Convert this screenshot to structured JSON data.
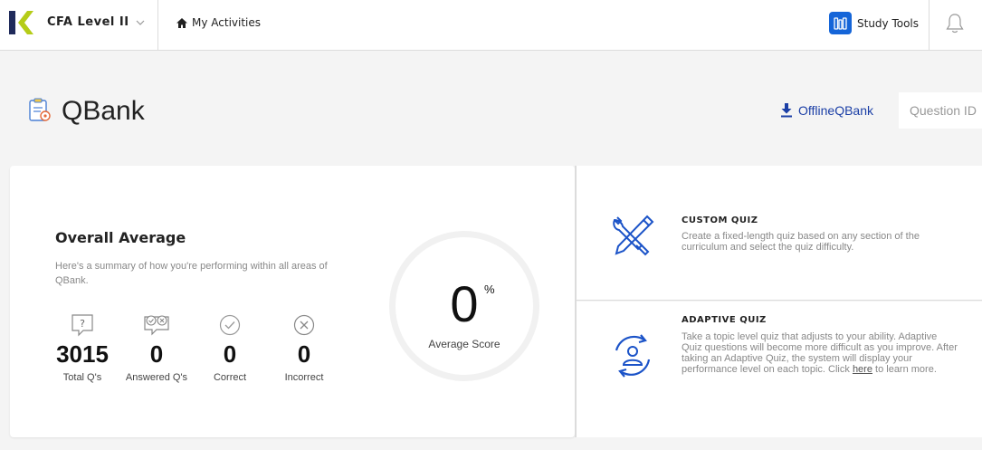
{
  "nav": {
    "course": "CFA Level II",
    "my_activities": "My Activities",
    "study_tools": "Study Tools"
  },
  "header": {
    "title": "QBank",
    "offline": "OfflineQBank",
    "question_id_placeholder": "Question ID"
  },
  "overall": {
    "title": "Overall Average",
    "description": "Here's a summary of how you're performing within all areas of QBank.",
    "stats": [
      {
        "value": "3015",
        "label": "Total Q's"
      },
      {
        "value": "0",
        "label": "Answered Q's"
      },
      {
        "value": "0",
        "label": "Correct"
      },
      {
        "value": "0",
        "label": "Incorrect"
      }
    ],
    "score": "0",
    "score_unit": "%",
    "score_label": "Average Score"
  },
  "quizzes": {
    "custom": {
      "title": "CUSTOM QUIZ",
      "description": "Create a fixed-length quiz based on any section of the curriculum and select the quiz difficulty."
    },
    "adaptive": {
      "title": "ADAPTIVE QUIZ",
      "description": "Take a topic level quiz that adjusts to your ability. Adaptive Quiz questions will become more difficult as you improve. After taking an Adaptive Quiz, the system will display your performance level on each topic. Click",
      "link": "here",
      "description_end": " to learn more."
    }
  },
  "colors": {
    "accent_blue": "#1565d8",
    "link_blue": "#1b3fa6",
    "logo_navy": "#1f2a5a",
    "logo_lime": "#b5cc18"
  }
}
